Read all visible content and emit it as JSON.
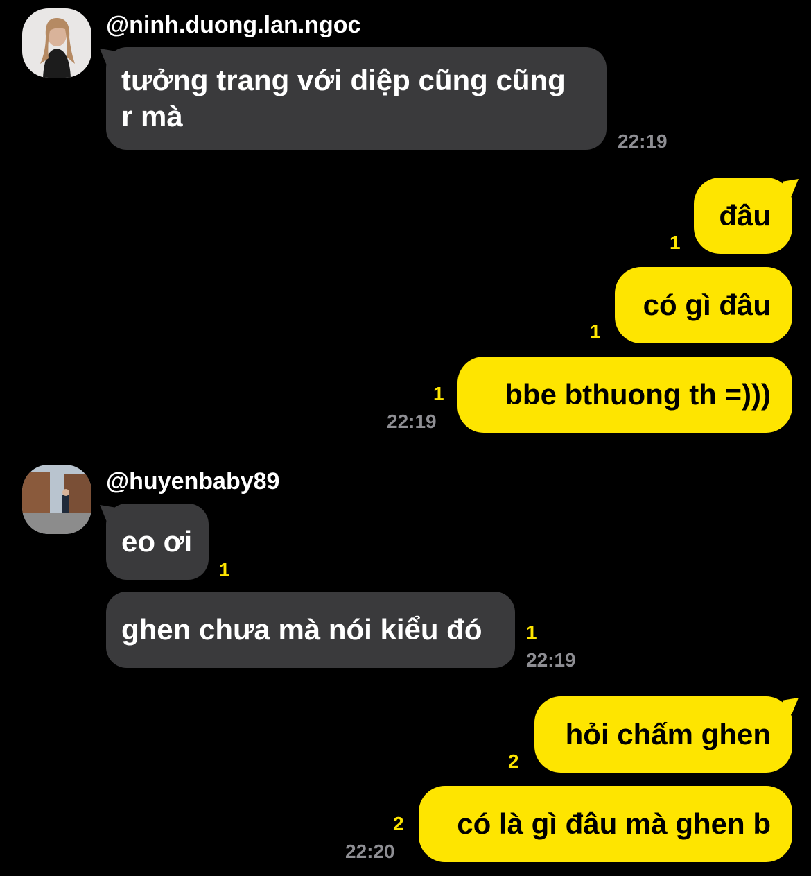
{
  "messages": [
    {
      "sender": "@ninh.duong.lan.ngoc",
      "text_line1": "tưởng trang với diệp cũng cũng",
      "text_line2": "r mà",
      "time": "22:19"
    },
    {
      "text": "đâu",
      "unread": "1"
    },
    {
      "text": "có gì đâu",
      "unread": "1"
    },
    {
      "text": "bbe bthuong th =)))",
      "unread": "1",
      "time": "22:19"
    },
    {
      "sender": "@huyenbaby89",
      "text": "eo ơi",
      "unread": "1"
    },
    {
      "text": "ghen chưa mà nói kiểu đó",
      "unread": "1",
      "time": "22:19"
    },
    {
      "text": "hỏi chấm ghen",
      "unread": "2"
    },
    {
      "text": "có là gì đâu mà ghen b",
      "unread": "2",
      "time": "22:20"
    }
  ],
  "colors": {
    "incoming_bubble": "#3a3a3c",
    "outgoing_bubble": "#fee500",
    "background": "#000000",
    "timestamp": "#8e8e93"
  }
}
